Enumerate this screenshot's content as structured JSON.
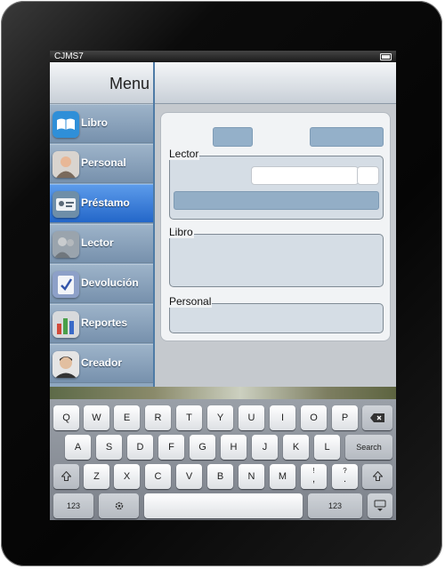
{
  "status": {
    "carrier": "CJMS7"
  },
  "sidebar": {
    "title": "Menu",
    "items": [
      {
        "label": "Libro",
        "icon": "book-icon",
        "active": false
      },
      {
        "label": "Personal",
        "icon": "person-icon",
        "active": false
      },
      {
        "label": "Préstamo",
        "icon": "id-card-icon",
        "active": true
      },
      {
        "label": "Lector",
        "icon": "reader-icon",
        "active": false
      },
      {
        "label": "Devolución",
        "icon": "return-check-icon",
        "active": false
      },
      {
        "label": "Reportes",
        "icon": "bar-chart-icon",
        "active": false
      },
      {
        "label": "Creador",
        "icon": "creator-avatar-icon",
        "active": false
      }
    ]
  },
  "form": {
    "sections": {
      "lector": "Lector",
      "libro": "Libro",
      "personal": "Personal"
    },
    "lector_input_value": "",
    "lector_input_placeholder": ""
  },
  "keyboard": {
    "row1": [
      "Q",
      "W",
      "E",
      "R",
      "T",
      "Y",
      "U",
      "I",
      "O",
      "P"
    ],
    "row2": [
      "A",
      "S",
      "D",
      "F",
      "G",
      "H",
      "J",
      "K",
      "L"
    ],
    "row3": [
      "Z",
      "X",
      "C",
      "V",
      "B",
      "N",
      "M"
    ],
    "search": "Search",
    "numbers": "123",
    "exclaim_top": "!",
    "exclaim_bottom": ",",
    "question_top": "?",
    "question_bottom": ".",
    "backspace_icon": "backspace-icon",
    "shift_icon": "shift-icon",
    "globe_icon": "settings-gear-icon",
    "hide_keyboard_icon": "hide-keyboard-icon"
  },
  "colors": {
    "active_item": "#2f75d6",
    "button_blue": "#94b0c9"
  }
}
